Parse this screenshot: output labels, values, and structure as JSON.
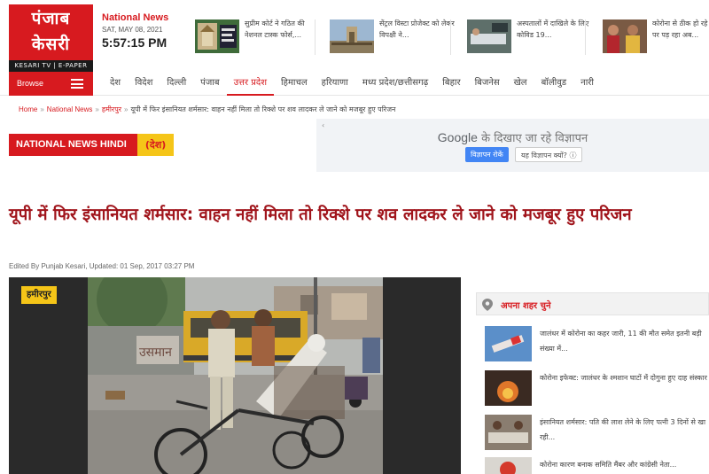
{
  "brand": {
    "logo_line1": "पंजाब",
    "logo_line2": "केसरी",
    "logo_strip": "KESARI TV  |  E-PAPER"
  },
  "header": {
    "section_title": "National News",
    "date": "SAT, MAY 08, 2021",
    "time": "5:57:15 PM"
  },
  "top_stories": [
    {
      "text": "सुप्रीम कोर्ट ने गठित की नेशनल टास्क फोर्स,..."
    },
    {
      "text": "सेंट्रल विस्टा प्रोजेक्ट को लेकर विपक्षी ने..."
    },
    {
      "text": "अस्पतालों में दाखिले के लिए कोविड 19..."
    },
    {
      "text": "कोरोना से ठीक हो रहे मरीजों पर पड़ रहा अब..."
    }
  ],
  "nav": {
    "browse_label": "Browse",
    "items": [
      {
        "label": "देश"
      },
      {
        "label": "विदेश"
      },
      {
        "label": "दिल्ली"
      },
      {
        "label": "पंजाब"
      },
      {
        "label": "उत्तर प्रदेश"
      },
      {
        "label": "हिमाचल"
      },
      {
        "label": "हरियाणा"
      },
      {
        "label": "मध्य प्रदेश/छत्तीसगढ़"
      },
      {
        "label": "बिहार"
      },
      {
        "label": "बिजनेस"
      },
      {
        "label": "खेल"
      },
      {
        "label": "बॉलीवुड"
      },
      {
        "label": "नारी"
      }
    ]
  },
  "breadcrumb": {
    "home": "Home",
    "section": "National News",
    "city": "हमीरपुर",
    "current": "यूपी में फिर इंसानियत शर्मसार: वाहन नहीं मिला तो रिक्शे पर शव लादकर ले जाने को मजबूर हुए परिजन",
    "separator": "»"
  },
  "section_badge": {
    "main": "NATIONAL NEWS HINDI",
    "sub": "(देश)"
  },
  "ad": {
    "back_arrow": "‹",
    "brand": "Google",
    "title_rest": " के दिखाए जा रहे विज्ञापन",
    "button_stop": "विज्ञापन रोकें",
    "button_why": "यह विज्ञापन क्यों? ⓘ"
  },
  "article": {
    "headline": "यूपी में फिर इंसानियत शर्मसार: वाहन नहीं मिला तो रिक्शे पर शव लादकर ले जाने को मजबूर हुए परिजन",
    "byline": "Edited By Punjab Kesari, Updated: 01 Sep, 2017 03:27 PM",
    "location_tag": "हमीरपुर",
    "wall_text": "उसमान"
  },
  "sidebar": {
    "title": "अपना शहर चुने",
    "items": [
      {
        "text": "जालंधर में कोरोना का कहर जारी, 11 की मौत समेत इतनी बड़ी संख्या में..."
      },
      {
        "text": "कोरोना इफेक्ट: जालंधर के श्मशान घाटों में दोगुना हुए दाह संस्कार"
      },
      {
        "text": "इंसानियत शर्मसार: पति की लाश लेने के लिए पत्नी 3 दिनों से खा रही..."
      },
      {
        "text": "कोरोना कारण बनाक समिति मैंबर और कांग्रेसी नेता..."
      }
    ]
  },
  "colors": {
    "brand_red": "#d71a1f",
    "headline_red": "#a0141b",
    "badge_yellow": "#f5c518"
  },
  "icons": {
    "menu": "hamburger-icon",
    "location": "map-pin-icon"
  }
}
